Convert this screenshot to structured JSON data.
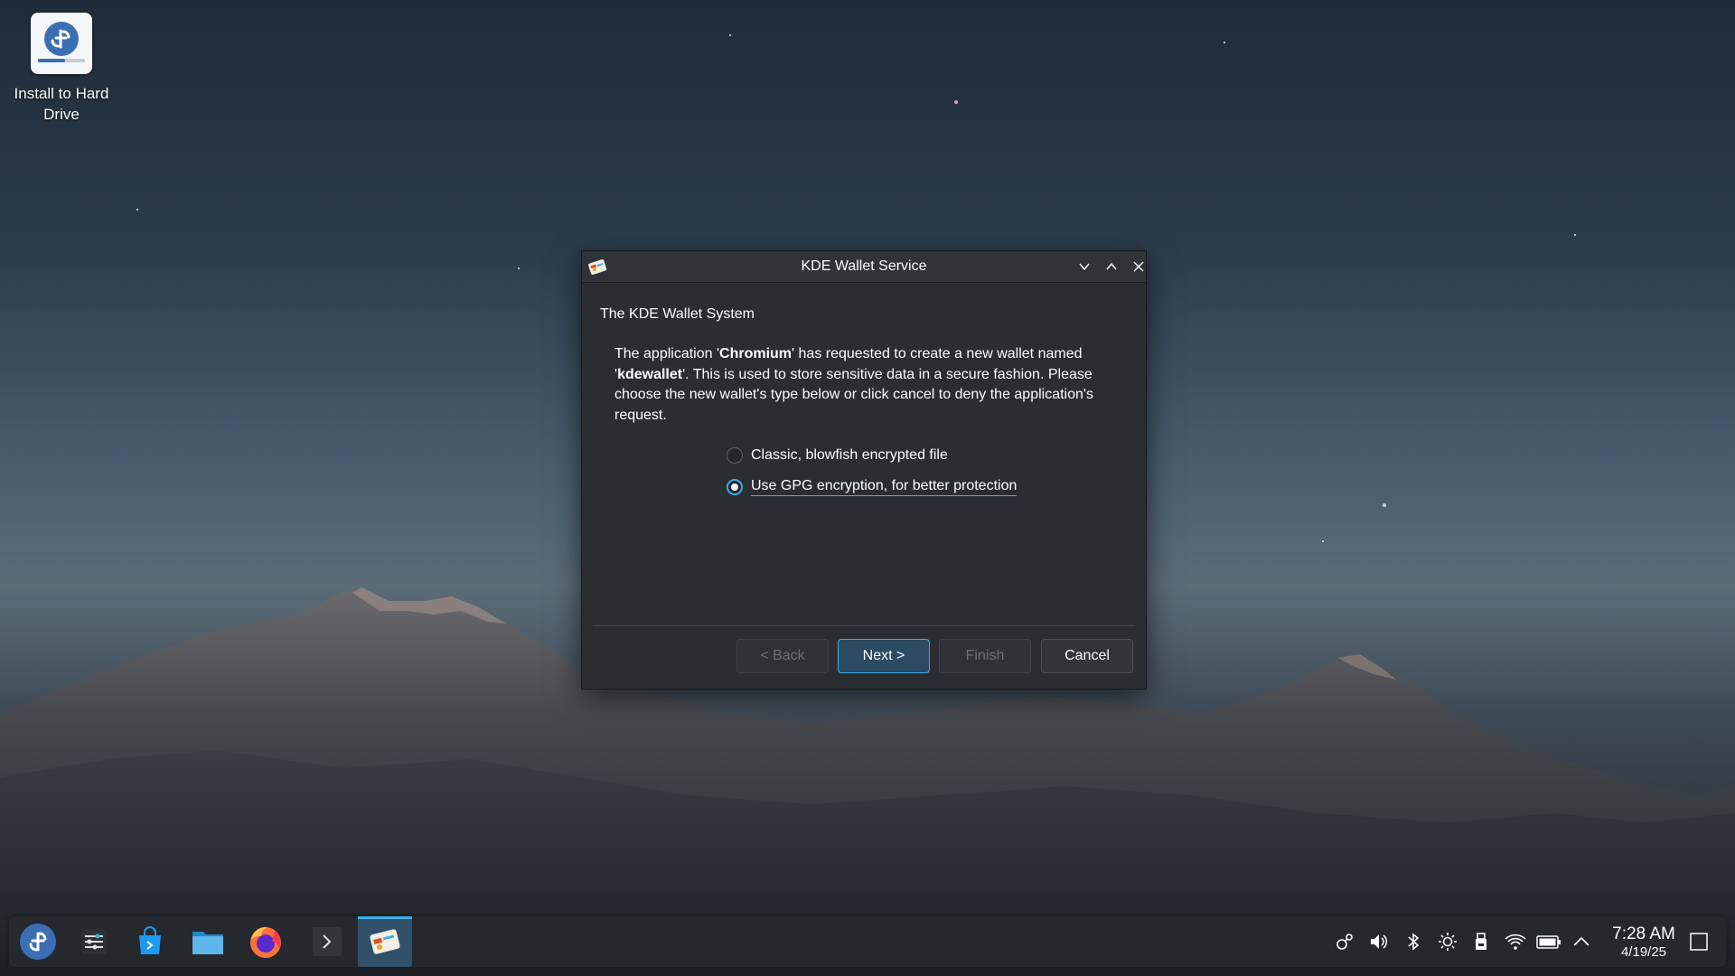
{
  "desktop": {
    "icons": [
      {
        "label": "Install to Hard Drive",
        "icon": "fedora-installer-icon"
      }
    ]
  },
  "dialog": {
    "window_title": "KDE Wallet Service",
    "app_icon": "kwallet-icon",
    "window_buttons": [
      "minimize",
      "maximize",
      "close"
    ],
    "section_title": "The KDE Wallet System",
    "message": {
      "part1": "The application '",
      "app_name": "Chromium",
      "part2": "' has requested to create a new wallet named '",
      "wallet_name": "kdewallet",
      "part3": "'. This is used to store sensitive data in a secure fashion. Please choose the new wallet's type below or click cancel to deny the application's request."
    },
    "options": [
      {
        "label": "Classic, blowfish encrypted file",
        "checked": false
      },
      {
        "label": "Use GPG encryption, for better protection",
        "checked": true
      }
    ],
    "buttons": {
      "back": "< Back",
      "next": "Next >",
      "finish": "Finish",
      "cancel": "Cancel"
    }
  },
  "taskbar": {
    "launchers": [
      "fedora-launcher-icon",
      "system-settings-icon",
      "discover-store-icon",
      "dolphin-files-icon",
      "firefox-icon",
      "konsole-terminal-icon",
      "kwallet-icon"
    ],
    "active": "kwallet-icon",
    "tray": [
      "kde-connect-icon",
      "volume-icon",
      "bluetooth-icon",
      "brightness-icon",
      "usb-drive-icon",
      "wifi-icon",
      "battery-icon",
      "tray-expand-icon"
    ],
    "clock": {
      "time": "7:28 AM",
      "date": "4/19/25"
    }
  },
  "colors": {
    "accent": "#3daee9",
    "dialog_bg": "#2a2e32",
    "taskbar_bg": "#25282d"
  }
}
